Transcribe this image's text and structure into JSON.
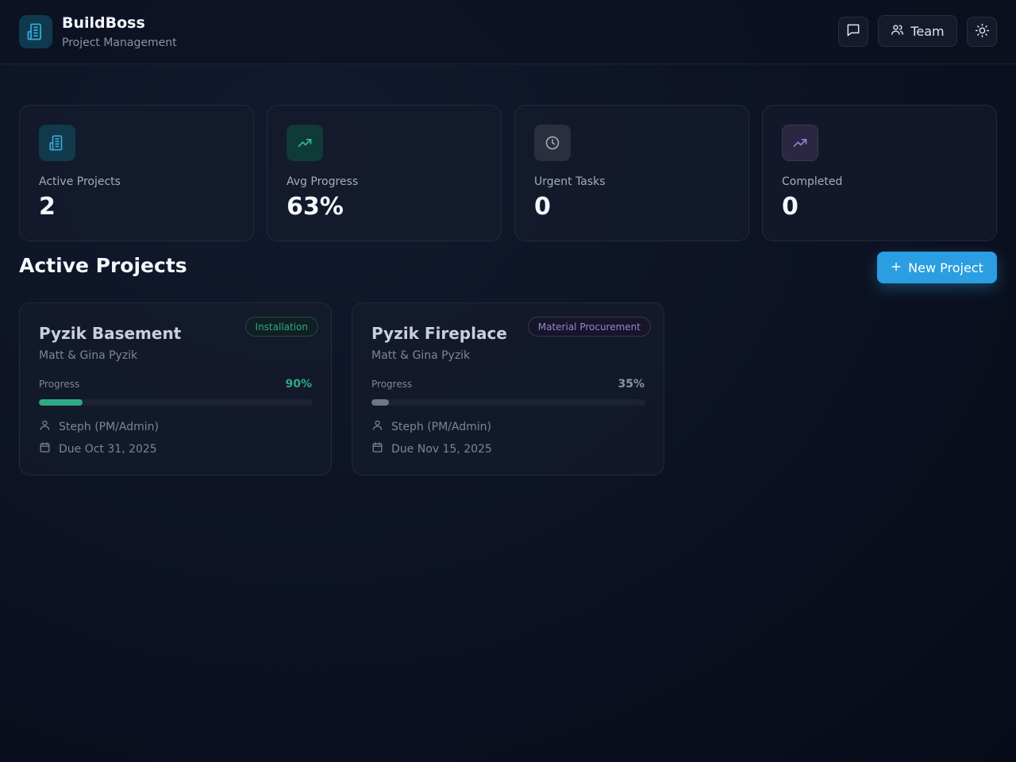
{
  "header": {
    "title": "BuildBoss",
    "subtitle": "Project Management",
    "team_label": "Team"
  },
  "stats": [
    {
      "label": "Active Projects",
      "value": "2",
      "icon": "building-icon",
      "color": "#3aa7d8"
    },
    {
      "label": "Avg Progress",
      "value": "63%",
      "icon": "trending-up-icon",
      "color": "#2fbf8a"
    },
    {
      "label": "Urgent Tasks",
      "value": "0",
      "icon": "clock-icon",
      "color": "#aab2c2"
    },
    {
      "label": "Completed",
      "value": "0",
      "icon": "trending-up-icon",
      "color": "#a07be0"
    }
  ],
  "section": {
    "title": "Active Projects",
    "new_button": "New Project"
  },
  "projects": [
    {
      "name": "Pyzik Basement",
      "client": "Matt & Gina Pyzik",
      "phase": "Installation",
      "progress_label": "Progress",
      "progress": 0.9,
      "progress_text": "90%",
      "assignee": "Steph (PM/Admin)",
      "due": "Due Oct 31, 2025",
      "color": "#2fbf8a"
    },
    {
      "name": "Pyzik Fireplace",
      "client": "Matt & Gina Pyzik",
      "phase": "Material Procurement",
      "progress_label": "Progress",
      "progress": 0.35,
      "progress_text": "35%",
      "assignee": "Steph (PM/Admin)",
      "due": "Due Nov 15, 2025",
      "color": "#6e7689"
    }
  ]
}
